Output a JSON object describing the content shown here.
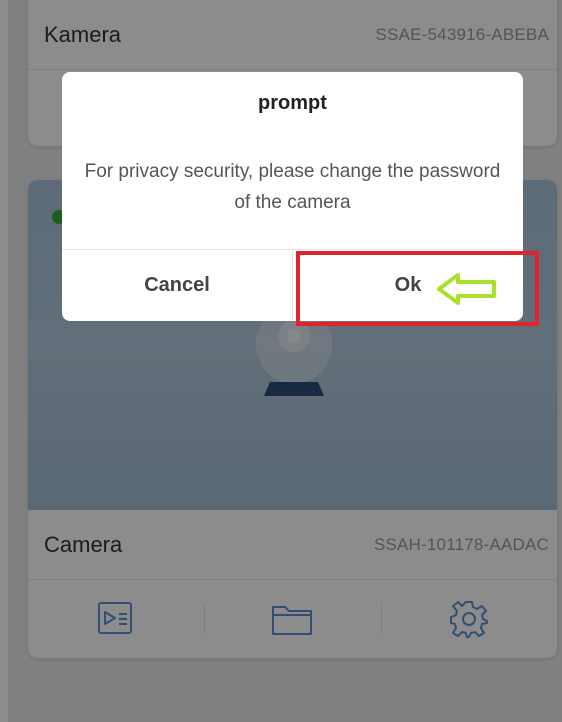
{
  "cameras": [
    {
      "name": "Kamera",
      "id": "SSAE-543916-ABEBA"
    },
    {
      "name": "Camera",
      "id": "SSAH-101178-AADAC"
    }
  ],
  "toolbar": {
    "icons": [
      "playback-list-icon",
      "folder-icon",
      "settings-gear-icon"
    ]
  },
  "dialog": {
    "title": "prompt",
    "message": "For privacy security, please change the password of the camera",
    "cancel_label": "Cancel",
    "ok_label": "Ok"
  },
  "annotation": {
    "highlight_color": "#e0242b",
    "arrow_color": "#a8e02a",
    "arrow_icon": "left-arrow-icon"
  },
  "colors": {
    "online_status": "#3daa35",
    "icon_blue": "#5b8fd6"
  }
}
